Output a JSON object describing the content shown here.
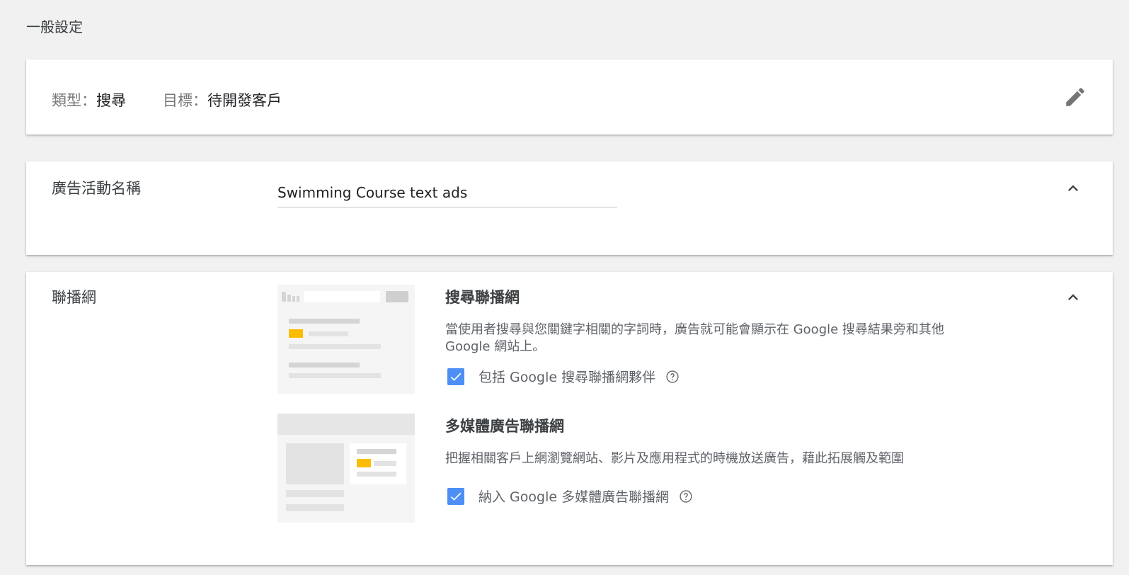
{
  "section_title": "一般設定",
  "type_card": {
    "type_key": "類型：",
    "type_value": "搜尋",
    "goal_key": "目標：",
    "goal_value": "待開發客戶",
    "edit_icon": "pencil-icon"
  },
  "name_card": {
    "label": "廣告活動名稱",
    "value": "Swimming Course text ads",
    "collapse_icon": "chevron-up-icon"
  },
  "network_card": {
    "label": "聯播網",
    "collapse_icon": "chevron-up-icon",
    "search": {
      "title": "搜尋聯播網",
      "description": "當使用者搜尋與您關鍵字相關的字詞時，廣告就可能會顯示在 Google 搜尋結果旁和其他 Google 網站上。",
      "checkbox_label": "包括 Google 搜尋聯播網夥伴",
      "checked": true
    },
    "display": {
      "title": "多媒體廣告聯播網",
      "description": "把握相關客戶上網瀏覽網站、影片及應用程式的時機放送廣告，藉此拓展觸及範圍",
      "checkbox_label": "納入 Google 多媒體廣告聯播網",
      "checked": true
    }
  },
  "colors": {
    "accent": "#4d8ff5",
    "ad_highlight": "#fbbc04",
    "background": "#f1f1f1"
  }
}
